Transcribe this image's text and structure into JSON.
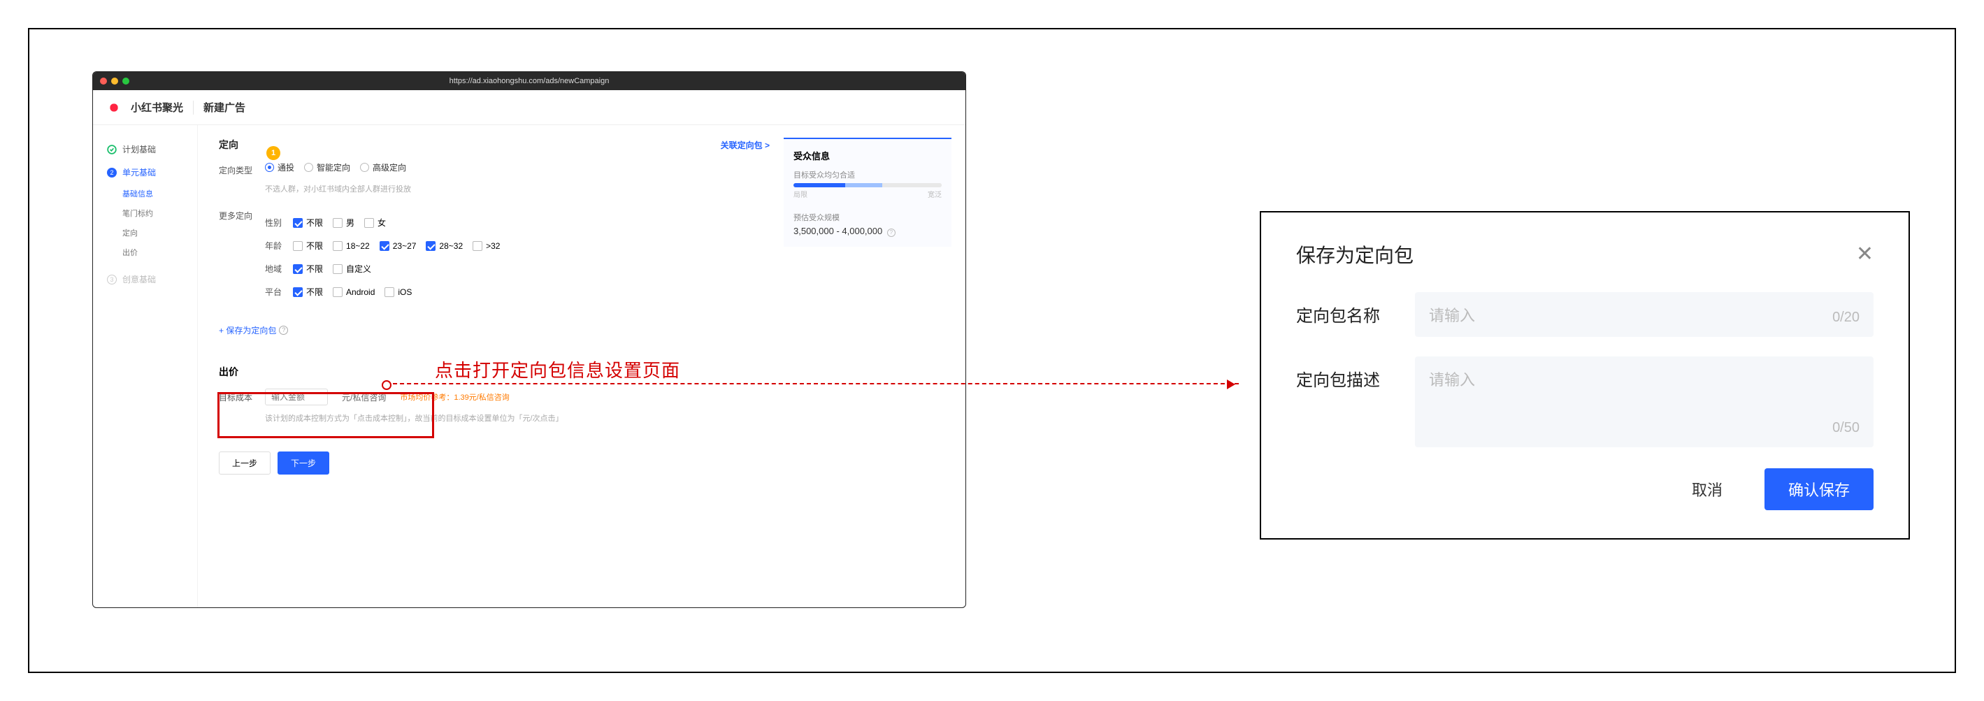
{
  "browser": {
    "url": "https://ad.xiaohongshu.com/ads/newCampaign"
  },
  "header": {
    "brand": "小红书聚光",
    "page_title": "新建广告"
  },
  "sidebar": {
    "items": [
      {
        "label": "计划基础",
        "state": "done"
      },
      {
        "label": "单元基础",
        "state": "active"
      },
      {
        "label": "基础信息",
        "state": "sub-active"
      },
      {
        "label": "笔门标约",
        "state": "sub"
      },
      {
        "label": "定向",
        "state": "sub"
      },
      {
        "label": "出价",
        "state": "sub"
      },
      {
        "label": "创意基础",
        "state": "pending"
      }
    ],
    "step_badge": "1"
  },
  "targeting": {
    "section_title": "定向",
    "link_associate": "关联定向包 >",
    "type_label": "定向类型",
    "type_options": [
      {
        "label": "通投",
        "checked": true
      },
      {
        "label": "智能定向",
        "checked": false
      },
      {
        "label": "高级定向",
        "checked": false
      }
    ],
    "type_hint": "不选人群，对小红书域内全部人群进行投放",
    "more_label": "更多定向",
    "gender": {
      "label": "性别",
      "options": [
        {
          "label": "不限",
          "checked": true
        },
        {
          "label": "男",
          "checked": false
        },
        {
          "label": "女",
          "checked": false
        }
      ]
    },
    "age": {
      "label": "年龄",
      "options": [
        {
          "label": "不限",
          "checked": false
        },
        {
          "label": "18~22",
          "checked": false
        },
        {
          "label": "23~27",
          "checked": true
        },
        {
          "label": "28~32",
          "checked": true
        },
        {
          "label": ">32",
          "checked": false
        }
      ]
    },
    "region": {
      "label": "地域",
      "options": [
        {
          "label": "不限",
          "checked": true
        },
        {
          "label": "自定义",
          "checked": false
        }
      ]
    },
    "platform": {
      "label": "平台",
      "options": [
        {
          "label": "不限",
          "checked": true
        },
        {
          "label": "Android",
          "checked": false
        },
        {
          "label": "iOS",
          "checked": false
        }
      ]
    },
    "save_as_pack": "+ 保存为定向包"
  },
  "bid": {
    "section_title": "出价",
    "target_cost_label": "目标成本",
    "input_placeholder": "输入金额",
    "unit": "元/私信咨询",
    "market_hint": "市场均价参考：1.39元/私信咨询",
    "note": "该计划的成本控制方式为「点击成本控制」，故当前的目标成本设置单位为「元/次点击」"
  },
  "footer": {
    "prev": "上一步",
    "next": "下一步"
  },
  "aside": {
    "title": "受众信息",
    "subtitle1": "目标受众均匀合适",
    "scale_left": "局限",
    "scale_right": "宽泛",
    "subtitle2": "预估受众规模",
    "estimate": "3,500,000 - 4,000,000"
  },
  "annotation": {
    "text": "点击打开定向包信息设置页面"
  },
  "dialog": {
    "title": "保存为定向包",
    "name_label": "定向包名称",
    "name_placeholder": "请输入",
    "name_counter": "0/20",
    "desc_label": "定向包描述",
    "desc_placeholder": "请输入",
    "desc_counter": "0/50",
    "cancel": "取消",
    "confirm": "确认保存"
  }
}
